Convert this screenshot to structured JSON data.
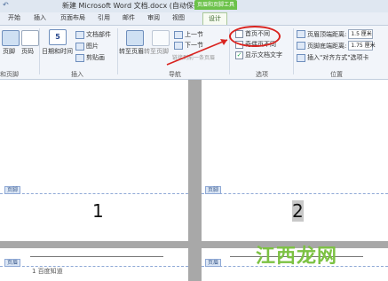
{
  "titlebar": {
    "undo_glyph": "↶",
    "title": "新建 Microsoft Word 文档.docx (自动保存的) - M...",
    "context_group": "页眉和页脚工具"
  },
  "tabs": {
    "items": [
      "开始",
      "插入",
      "页面布局",
      "引用",
      "邮件",
      "审阅",
      "视图"
    ],
    "active": "设计"
  },
  "ribbon": {
    "header_footer_group": {
      "footer_label": "页脚",
      "page_num_label": "页码",
      "group_label": "和页脚"
    },
    "insert_group": {
      "date_time": "日期和时间",
      "doc_parts": "文档部件",
      "picture": "图片",
      "clipart": "剪贴画",
      "group_label": "插入"
    },
    "nav_group": {
      "goto_header": "转至页眉",
      "goto_footer": "转至页脚",
      "prev_section": "上一节",
      "next_section": "下一节",
      "link_prev": "链接到前一条页眉",
      "group_label": "导航"
    },
    "options_group": {
      "first_page": "首页不同",
      "odd_even": "奇偶页不同",
      "show_text": "显示文档文字",
      "group_label": "选项"
    },
    "position_group": {
      "header_top": "页眉顶端距离:",
      "header_top_value": "1.5 厘米",
      "footer_bottom": "页脚底端距离:",
      "footer_bottom_value": "1.75 厘米",
      "insert_tab": "插入\"对齐方式\"选项卡",
      "group_label": "位置"
    }
  },
  "document": {
    "footer_tag": "页脚",
    "page1_number": "1",
    "page2_number": "2",
    "header_tag": "页眉",
    "page3_text": "1 百度知道"
  },
  "watermark": "江西龙网",
  "colors": {
    "accent_green": "#6cc24a",
    "annotation_red": "#d9231f"
  }
}
